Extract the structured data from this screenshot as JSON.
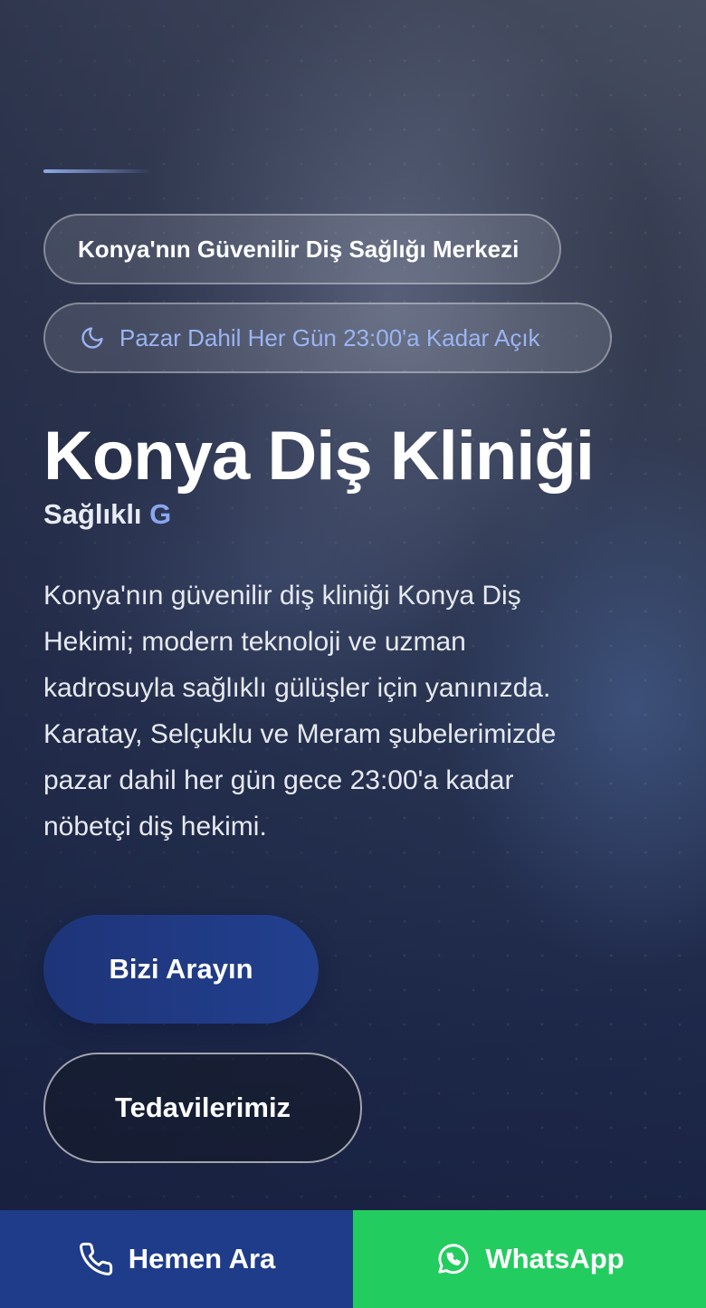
{
  "hero": {
    "badge_primary": "Konya'nın Güvenilir Diş Sağlığı Merkezi",
    "badge_secondary": "Pazar Dahil Her Gün 23:00'a Kadar Açık",
    "badge_secondary_icon": "moon-icon",
    "title": "Konya Diş Kliniği",
    "subtitle_white": "Sağlıklı",
    "subtitle_blue": "G",
    "description_lines": [
      "Konya'nın güvenilir diş kliniği Konya Diş",
      "Hekimi; modern teknoloji ve uzman",
      "kadrosuyla sağlıklı gülüşler için yanınızda.",
      "Karatay, Selçuklu ve Meram şubelerimizde",
      "pazar dahil her gün gece 23:00'a kadar",
      "nöbetçi diş hekimi."
    ],
    "cta_call_label": "Bizi Arayın",
    "cta_treatments_label": "Tedavilerimiz"
  },
  "bottom_bar": {
    "call_label": "Hemen Ara",
    "call_icon": "phone-icon",
    "whatsapp_label": "WhatsApp",
    "whatsapp_icon": "whatsapp-icon"
  },
  "colors": {
    "accent_blue": "#8aa6ee",
    "call_bar": "#1e3c8a",
    "whatsapp_bar": "#23cc5f",
    "cta_call": "#22408f"
  }
}
